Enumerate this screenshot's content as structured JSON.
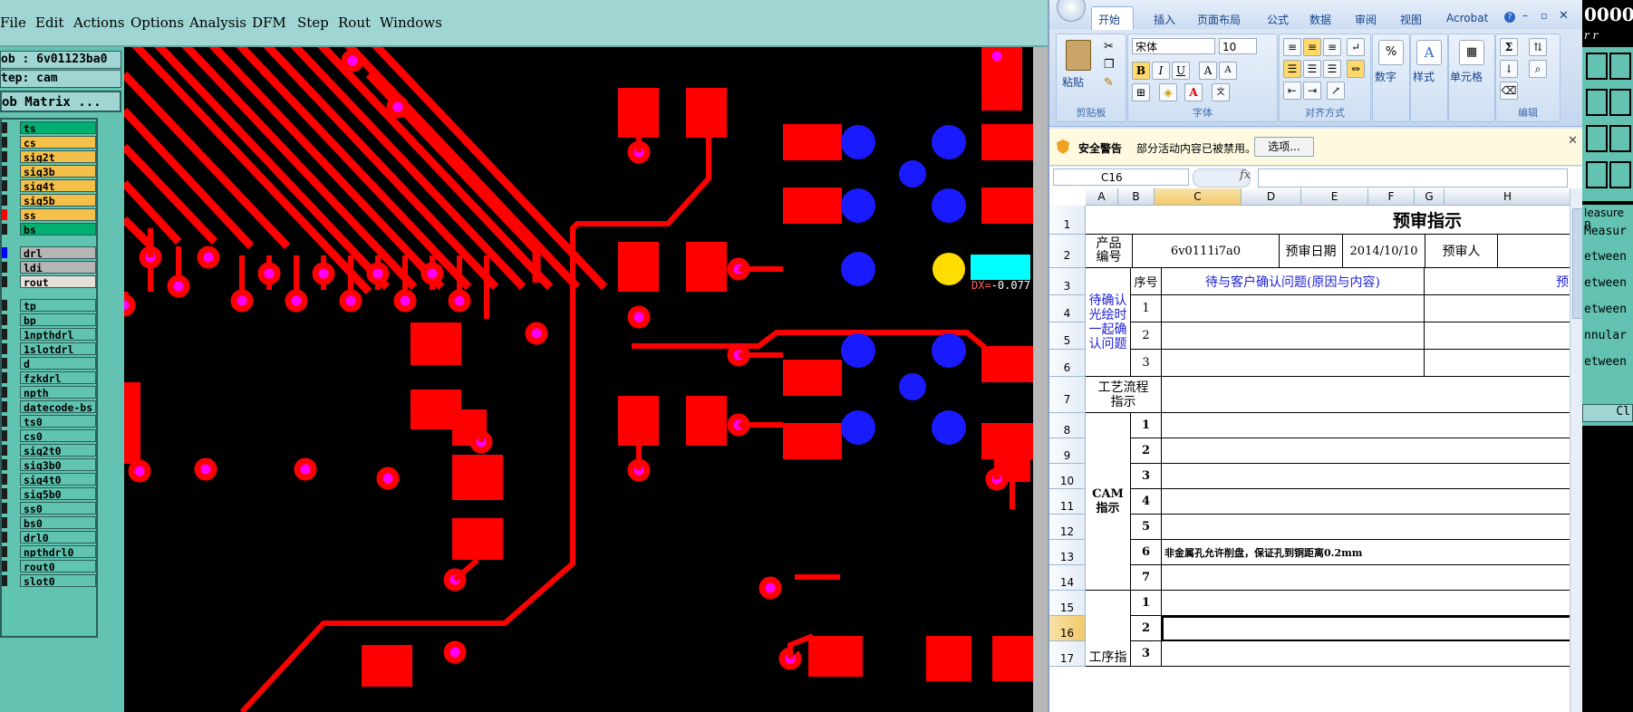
{
  "cam": {
    "menu": [
      "File",
      "Edit",
      "Actions",
      "Options",
      "Analysis",
      "DFM",
      "Step",
      "Rout",
      "Windows"
    ],
    "job_label": "ob : 6v01123ba0",
    "step_label": "tep: cam",
    "matrix_button": "ob Matrix ...",
    "layers": [
      {
        "name": "ts",
        "color": "#00b070",
        "chk": "off"
      },
      {
        "name": "cs",
        "color": "#f5c04a",
        "chk": "off"
      },
      {
        "name": "sig2t",
        "color": "#f5c04a",
        "chk": "off"
      },
      {
        "name": "sig3b",
        "color": "#f5c04a",
        "chk": "off"
      },
      {
        "name": "sig4t",
        "color": "#f5c04a",
        "chk": "off"
      },
      {
        "name": "sig5b",
        "color": "#f5c04a",
        "chk": "off"
      },
      {
        "name": "ss",
        "color": "#f5c04a",
        "chk": "red"
      },
      {
        "name": "bs",
        "color": "#00b070",
        "chk": "off"
      },
      {
        "name": "drl",
        "color": "#b5b5b5",
        "chk": "blue"
      },
      {
        "name": "ldi",
        "color": "#b5b5b5",
        "chk": "off"
      },
      {
        "name": "rout",
        "color": "#e6e0d8",
        "chk": "off"
      },
      {
        "name": "tp",
        "color": "#60c4b0",
        "chk": "off"
      },
      {
        "name": "bp",
        "color": "#60c4b0",
        "chk": "off"
      },
      {
        "name": "1npthdrl",
        "color": "#60c4b0",
        "chk": "off"
      },
      {
        "name": "1slotdrl",
        "color": "#60c4b0",
        "chk": "off"
      },
      {
        "name": "d",
        "color": "#60c4b0",
        "chk": "off"
      },
      {
        "name": "fzkdrl",
        "color": "#60c4b0",
        "chk": "off"
      },
      {
        "name": "npth",
        "color": "#60c4b0",
        "chk": "off"
      },
      {
        "name": "datecode-bs",
        "color": "#60c4b0",
        "chk": "off"
      },
      {
        "name": "ts0",
        "color": "#60c4b0",
        "chk": "off"
      },
      {
        "name": "cs0",
        "color": "#60c4b0",
        "chk": "off"
      },
      {
        "name": "sig2t0",
        "color": "#60c4b0",
        "chk": "off"
      },
      {
        "name": "sig3b0",
        "color": "#60c4b0",
        "chk": "off"
      },
      {
        "name": "sig4t0",
        "color": "#60c4b0",
        "chk": "off"
      },
      {
        "name": "sig5b0",
        "color": "#60c4b0",
        "chk": "off"
      },
      {
        "name": "ss0",
        "color": "#60c4b0",
        "chk": "off"
      },
      {
        "name": "bs0",
        "color": "#60c4b0",
        "chk": "off"
      },
      {
        "name": "drl0",
        "color": "#60c4b0",
        "chk": "off"
      },
      {
        "name": "npthdrl0",
        "color": "#60c4b0",
        "chk": "off"
      },
      {
        "name": "rout0",
        "color": "#60c4b0",
        "chk": "off"
      },
      {
        "name": "slot0",
        "color": "#60c4b0",
        "chk": "off"
      }
    ],
    "dx_prefix": "DX=",
    "dx_value": "-0.077"
  },
  "excel": {
    "tabs": [
      "开始",
      "插入",
      "页面布局",
      "公式",
      "数据",
      "审阅",
      "视图",
      "Acrobat"
    ],
    "ribbon": {
      "paste": "粘贴",
      "clipboard": "剪贴板",
      "font_name": "宋体",
      "font_size": "10",
      "font_group": "字体",
      "align_group": "对齐方式",
      "number": "数字",
      "style": "样式",
      "cells": "单元格",
      "edit_group": "编辑"
    },
    "security_title": "安全警告",
    "security_msg": "部分活动内容已被禁用。",
    "security_btn": "选项...",
    "name_box": "C16",
    "fx": "fx",
    "columns": [
      "A",
      "B",
      "C",
      "D",
      "E",
      "F",
      "G",
      "H"
    ],
    "rows": [
      "1",
      "2",
      "3",
      "4",
      "5",
      "6",
      "7",
      "8",
      "9",
      "10",
      "11",
      "12",
      "13",
      "14",
      "15",
      "16",
      "17"
    ],
    "sheet": {
      "title": "预审指示",
      "product_label": "产品编号",
      "product_value": "6v0111i7a0",
      "date_label": "预审日期",
      "date_value": "2014/10/10",
      "reviewer_label": "预审人",
      "confirm_label": "待确认光绘时一起确认问题",
      "seq_header": "序号",
      "issue_header": "待与客户确认问题(原因与内容)",
      "pre_header": "预",
      "process_label": "工艺流程指示",
      "cam_label": "CAM指示",
      "note_row13": "非金属孔允许削盘，保证孔到铜距离0.2mm",
      "proc_label2": "工序指",
      "nums_confirm": [
        "1",
        "2",
        "3"
      ],
      "nums_cam": [
        "1",
        "2",
        "3",
        "4",
        "5",
        "6",
        "7"
      ],
      "nums_proc": [
        "1",
        "2",
        "3"
      ]
    }
  },
  "right_strip": {
    "top_text": "0000",
    "sub_text": "r r",
    "measure_title": "leasure P",
    "items": [
      "Measur",
      "etween",
      "etween",
      "etween",
      "nnular",
      "etween"
    ],
    "close": "Cl"
  }
}
